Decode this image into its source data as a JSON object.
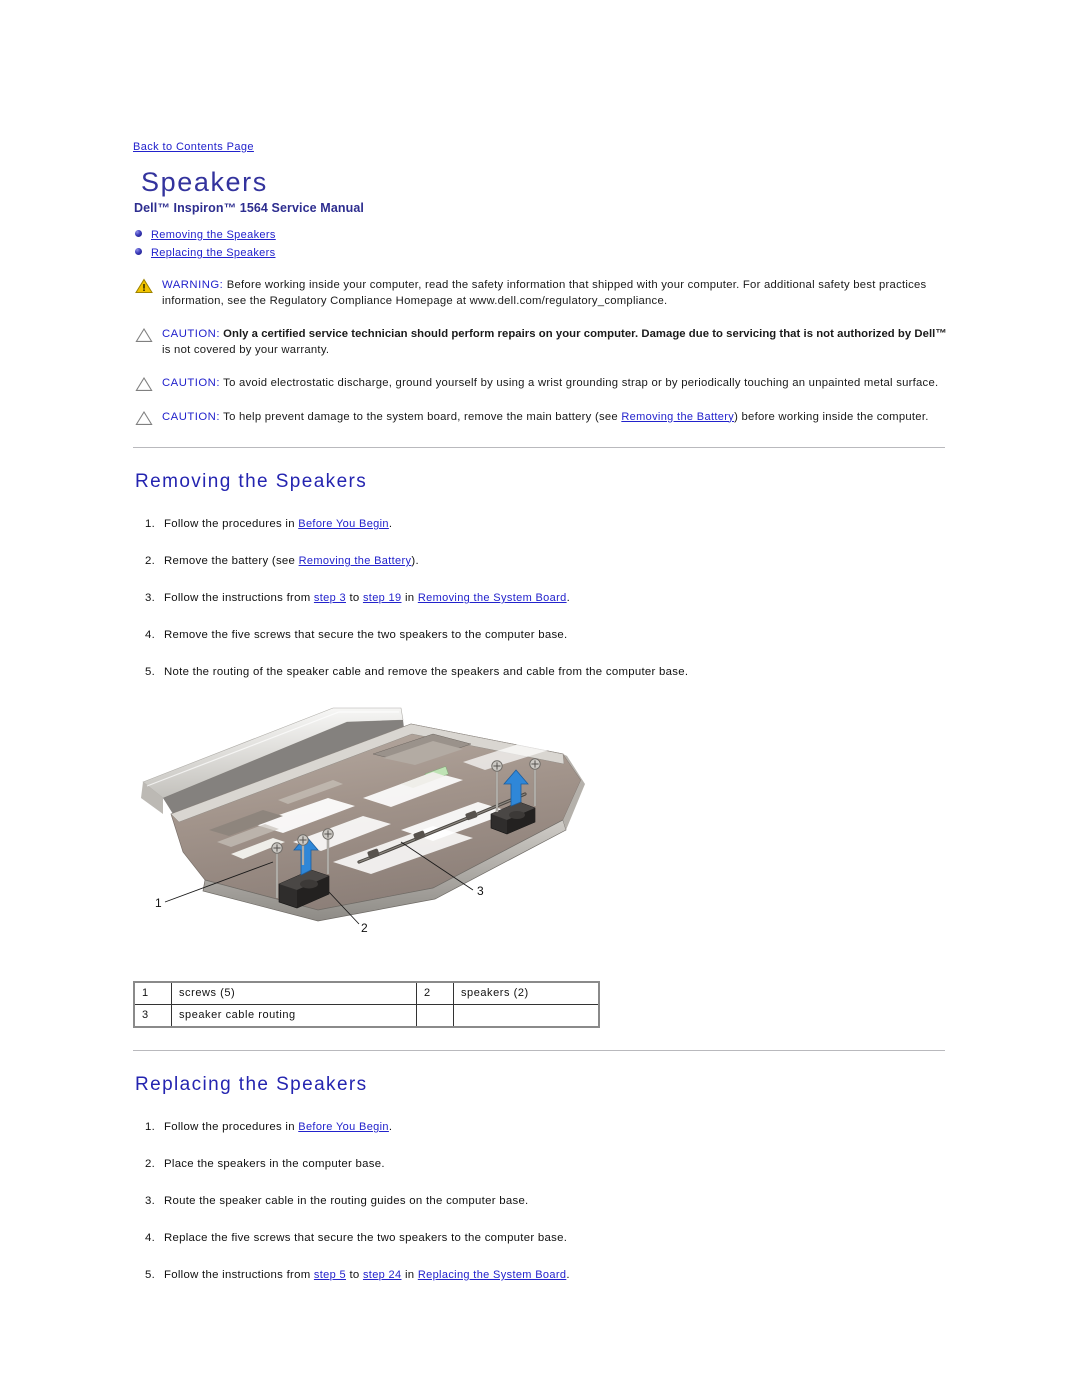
{
  "document": {
    "back_link": "Back to Contents Page",
    "title": "Speakers",
    "subtitle": "Dell™ Inspiron™ 1564 Service Manual"
  },
  "toc": {
    "items": [
      {
        "label": "Removing the Speakers"
      },
      {
        "label": "Replacing the Speakers"
      }
    ]
  },
  "notices": [
    {
      "icon": "warning-triangle-icon",
      "label": "WARNING:",
      "text": " Before working inside your computer, read the safety information that shipped with your computer. For additional safety best practices information, see the Regulatory Compliance Homepage at www.dell.com/regulatory_compliance."
    },
    {
      "icon": "caution-triangle-icon",
      "label": "CAUTION:",
      "bold_text": " Only a certified service technician should perform repairs on your computer. Damage due to servicing that is not authorized by Dell™",
      "text": " is not covered by your warranty."
    },
    {
      "icon": "caution-triangle-icon",
      "label": "CAUTION:",
      "text": " To avoid electrostatic discharge, ground yourself by using a wrist grounding strap or by periodically touching an unpainted metal surface."
    },
    {
      "icon": "caution-triangle-icon",
      "label": "CAUTION:",
      "text_before": " To help prevent damage to the system board, remove the main battery (see ",
      "link": "Removing the Battery",
      "text_after": ") before working inside the computer."
    }
  ],
  "removing": {
    "heading": "Removing the Speakers",
    "steps": [
      {
        "text_before": "Follow the procedures in ",
        "link": "Before You Begin",
        "text_after": "."
      },
      {
        "text_before": "Remove the battery (see ",
        "link": "Removing the Battery",
        "text_after": ")."
      },
      {
        "text_before": "Follow the instructions from ",
        "link": "step 3",
        "text_mid": " to ",
        "link2": "step 19",
        "text_mid2": " in ",
        "link3": "Removing the System Board",
        "text_after": "."
      },
      {
        "text_before": "Remove the five screws that secure the two speakers to the computer base."
      },
      {
        "text_before": "Note the routing of the speaker cable and remove the speakers and cable from the computer base."
      }
    ]
  },
  "figure": {
    "name": "speaker-removal-diagram",
    "callouts": [
      {
        "num": "1",
        "label": "screws (5)"
      },
      {
        "num": "2",
        "label": "speakers (2)"
      },
      {
        "num": "3",
        "label": "speaker cable routing"
      }
    ],
    "table_rows": [
      {
        "n1": "1",
        "v1": "screws (5)",
        "n2": "2",
        "v2": "speakers (2)"
      },
      {
        "n1": "3",
        "v1": "speaker cable routing",
        "n2": "",
        "v2": ""
      }
    ]
  },
  "replacing": {
    "heading": "Replacing the Speakers",
    "steps": [
      {
        "text_before": "Follow the procedures in ",
        "link": "Before You Begin",
        "text_after": "."
      },
      {
        "text_before": "Place the speakers in the computer base."
      },
      {
        "text_before": "Route the speaker cable in the routing guides on the computer base."
      },
      {
        "text_before": "Replace the five screws that secure the two speakers to the computer base."
      },
      {
        "text_before": "Follow the instructions from ",
        "link": "step 5",
        "text_mid": " to ",
        "link2": "step 24",
        "text_mid2": " in ",
        "link3": "Replacing the System Board",
        "text_after": "."
      }
    ]
  },
  "colors": {
    "link": "#2222cc",
    "title": "#33339d",
    "section_heading": "#2424b0",
    "warning_icon": "#f2c400",
    "arrow": "#2f87d8"
  }
}
